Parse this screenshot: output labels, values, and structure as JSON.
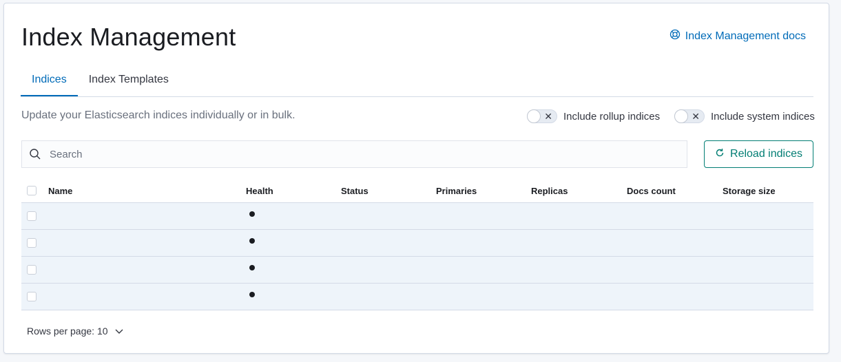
{
  "page": {
    "title": "Index Management",
    "docs_link": "Index Management docs",
    "description": "Update your Elasticsearch indices individually or in bulk."
  },
  "tabs": [
    {
      "label": "Indices",
      "active": true
    },
    {
      "label": "Index Templates",
      "active": false
    }
  ],
  "toggles": {
    "rollup": {
      "label": "Include rollup indices",
      "on": false
    },
    "system": {
      "label": "Include system indices",
      "on": false
    }
  },
  "search": {
    "placeholder": "Search",
    "value": ""
  },
  "reload_button": "Reload indices",
  "table": {
    "columns": [
      "Name",
      "Health",
      "Status",
      "Primaries",
      "Replicas",
      "Docs count",
      "Storage size"
    ],
    "rows": [
      {
        "name": "",
        "health": "●",
        "status": "",
        "primaries": "",
        "replicas": "",
        "docs_count": "",
        "storage_size": ""
      },
      {
        "name": "",
        "health": "●",
        "status": "",
        "primaries": "",
        "replicas": "",
        "docs_count": "",
        "storage_size": ""
      },
      {
        "name": "",
        "health": "●",
        "status": "",
        "primaries": "",
        "replicas": "",
        "docs_count": "",
        "storage_size": ""
      },
      {
        "name": "",
        "health": "●",
        "status": "",
        "primaries": "",
        "replicas": "",
        "docs_count": "",
        "storage_size": ""
      }
    ]
  },
  "pagination": {
    "rows_per_page_label": "Rows per page: 10"
  },
  "colors": {
    "link": "#006bb8",
    "accent": "#017d73",
    "row_bg": "#eef4fa"
  }
}
